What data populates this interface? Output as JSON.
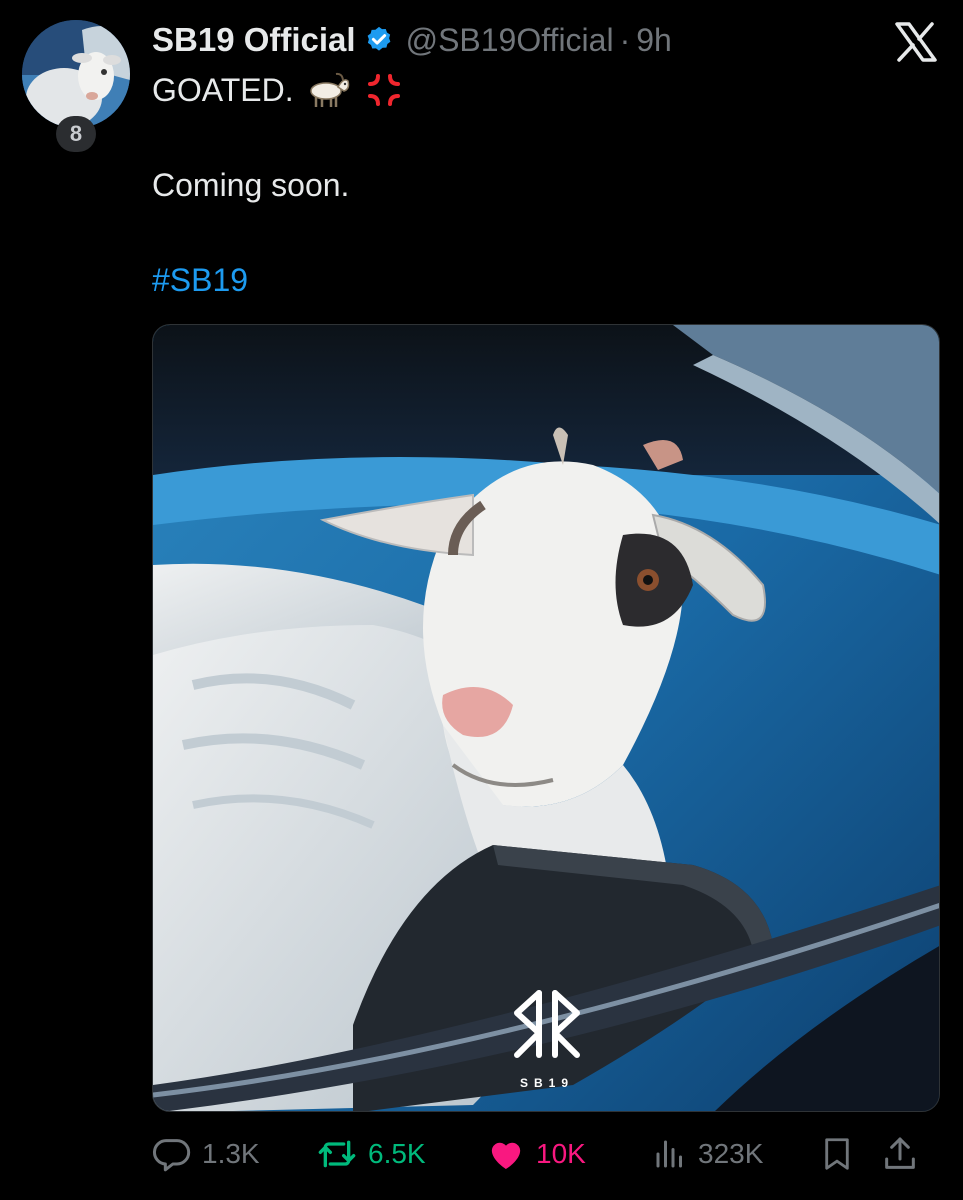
{
  "post": {
    "display_name": "SB19 Official",
    "handle": "@SB19Official",
    "separator": "·",
    "time": "9h",
    "avatar_badge": "8",
    "text_line1": "GOATED.",
    "text_line2": "Coming soon.",
    "hashtag": "#SB19",
    "emojis": [
      "goat-emoji",
      "anger-symbol-emoji"
    ]
  },
  "media": {
    "logo_text": "SB19"
  },
  "actions": {
    "replies": "1.3K",
    "reposts": "6.5K",
    "likes": "10K",
    "views": "323K"
  },
  "colors": {
    "background": "#000000",
    "text": "#e7e9ea",
    "muted": "#71767b",
    "link": "#1d9bf0",
    "verified": "#1d9bf0",
    "repost": "#00ba7c",
    "like": "#f91880"
  },
  "icons": {
    "verified": "verified-badge-icon",
    "platform": "x-logo-icon",
    "reply": "reply-icon",
    "repost": "repost-icon",
    "like": "heart-icon",
    "views": "views-icon",
    "bookmark": "bookmark-icon",
    "share": "share-icon"
  }
}
